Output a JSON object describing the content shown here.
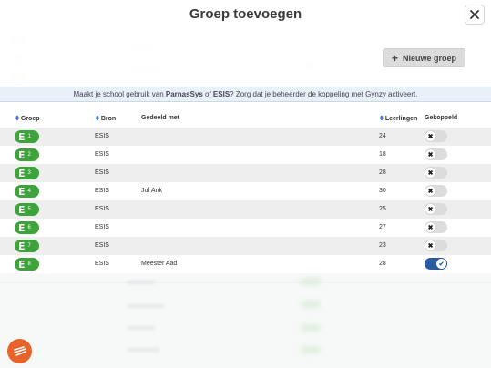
{
  "modal": {
    "title": "Groep toevoegen",
    "close_icon": "close-icon",
    "new_group_label": "Nieuwe groep"
  },
  "notice": {
    "prefix": "Maakt je school gebruik van ",
    "system1": "ParnasSys",
    "mid": " of ",
    "system2": "ESIS",
    "suffix": "? Zorg dat je beheerder de koppeling met Gynzy activeert."
  },
  "table": {
    "headers": {
      "group": "Groep",
      "source": "Bron",
      "shared": "Gedeeld met",
      "students": "Leerlingen",
      "linked": "Gekoppeld"
    },
    "rows": [
      {
        "letter": "E",
        "num": "1",
        "source": "ESIS",
        "shared": "",
        "students": "24",
        "linked": false
      },
      {
        "letter": "E",
        "num": "2",
        "source": "ESIS",
        "shared": "",
        "students": "18",
        "linked": false
      },
      {
        "letter": "E",
        "num": "3",
        "source": "ESIS",
        "shared": "",
        "students": "28",
        "linked": false
      },
      {
        "letter": "E",
        "num": "4",
        "source": "ESIS",
        "shared": "Juf Ank",
        "students": "30",
        "linked": false
      },
      {
        "letter": "E",
        "num": "5",
        "source": "ESIS",
        "shared": "",
        "students": "25",
        "linked": false
      },
      {
        "letter": "E",
        "num": "6",
        "source": "ESIS",
        "shared": "",
        "students": "27",
        "linked": false
      },
      {
        "letter": "E",
        "num": "7",
        "source": "ESIS",
        "shared": "",
        "students": "23",
        "linked": false
      },
      {
        "letter": "E",
        "num": "8",
        "source": "ESIS",
        "shared": "Meester Aad",
        "students": "28",
        "linked": true
      }
    ]
  },
  "colors": {
    "badge": "#3ea33a",
    "toggle_on": "#2c5aa0",
    "logo": "#e8632a"
  }
}
